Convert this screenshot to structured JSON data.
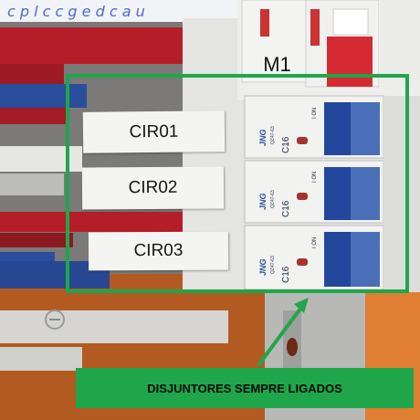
{
  "photo": {
    "labels": [
      "CIR01",
      "CIR02",
      "CIR03"
    ],
    "main_breaker_label": "M1",
    "breaker_rating": "C16",
    "breaker_brand": "JNG",
    "breaker_model": "QZ47-63",
    "breaker_on_text": "I ON",
    "caption": "DISJUNTORES SEMPRE LIGADOS",
    "highlight_color": "#1fa64b"
  }
}
